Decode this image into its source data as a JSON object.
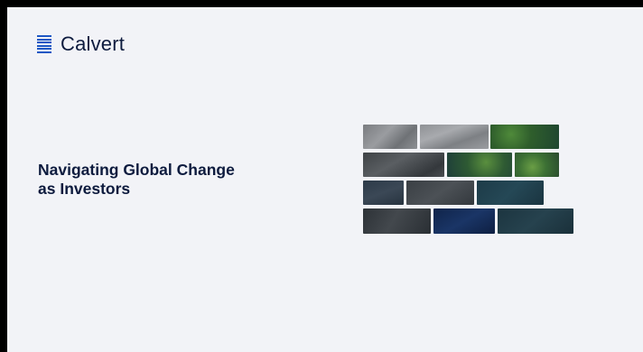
{
  "brand": {
    "name": "Calvert",
    "icon": "stacked-lines-logo-icon",
    "accent": "#1f58c4"
  },
  "slide": {
    "title_line1": "Navigating Global Change",
    "title_line2": "as Investors"
  },
  "colors": {
    "background": "#f2f3f7",
    "text": "#0d1b3e"
  },
  "image_tiles": [
    "aerial-road-image",
    "aerial-road-image",
    "aerial-forest-image",
    "aerial-city-image",
    "aerial-forest-image",
    "aerial-forest-image",
    "aerial-building-image",
    "aerial-rooftop-image",
    "aerial-water-image",
    "aerial-street-image",
    "aerial-water-image",
    "aerial-water-image"
  ]
}
